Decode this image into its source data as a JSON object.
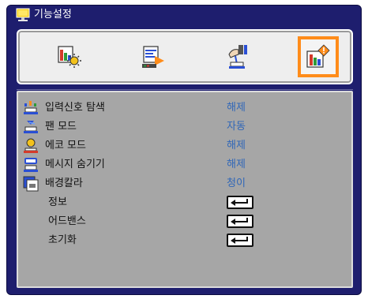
{
  "window": {
    "title": "기능설정",
    "icon": "settings-board-icon"
  },
  "toolbar": {
    "tabs": [
      {
        "icon": "image-adjust-icon",
        "selected": false
      },
      {
        "icon": "display-setup-icon",
        "selected": false
      },
      {
        "icon": "setup-hand-icon",
        "selected": false
      },
      {
        "icon": "options-info-icon",
        "selected": true
      }
    ],
    "selected_border_color": "#ff8c1a"
  },
  "menu": {
    "items": [
      {
        "label": "입력신호 탐색",
        "value": "해제",
        "icon": "input-search-icon"
      },
      {
        "label": "팬 모드",
        "value": "자동",
        "icon": "fan-mode-icon"
      },
      {
        "label": "에코 모드",
        "value": "해제",
        "icon": "eco-mode-icon"
      },
      {
        "label": "메시지 숨기기",
        "value": "해제",
        "icon": "message-hide-icon"
      },
      {
        "label": "배경칼라",
        "value": "청이",
        "icon": "background-color-icon"
      },
      {
        "label": "정보",
        "action": "enter-key-icon"
      },
      {
        "label": "어드밴스",
        "action": "enter-key-icon"
      },
      {
        "label": "초기화",
        "action": "enter-key-icon"
      }
    ],
    "value_color": "#2f66b8"
  }
}
